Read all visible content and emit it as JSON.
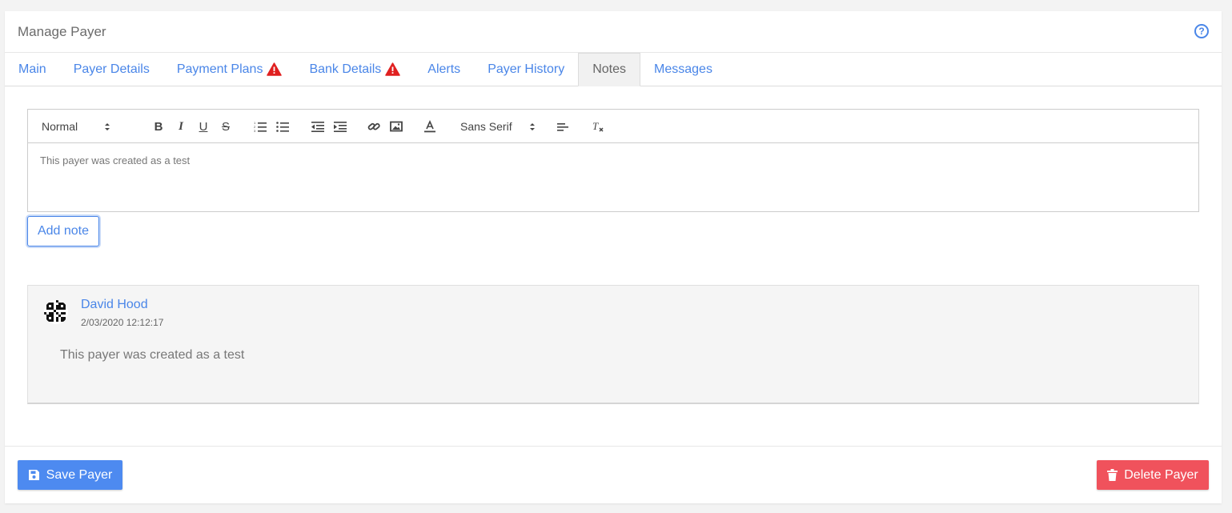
{
  "header": {
    "title": "Manage Payer",
    "help_icon": "question-circle-icon"
  },
  "tabs": [
    {
      "label": "Main",
      "warning": false
    },
    {
      "label": "Payer Details",
      "warning": false
    },
    {
      "label": "Payment Plans",
      "warning": true
    },
    {
      "label": "Bank Details",
      "warning": true
    },
    {
      "label": "Alerts",
      "warning": false
    },
    {
      "label": "Payer History",
      "warning": false
    },
    {
      "label": "Notes",
      "warning": false,
      "active": true
    },
    {
      "label": "Messages",
      "warning": false
    }
  ],
  "editor": {
    "heading_select": "Normal",
    "font_select": "Sans Serif",
    "content": "This payer was created as a test"
  },
  "add_note_label": "Add note",
  "notes": [
    {
      "author": "David Hood",
      "date": "2/03/2020 12:12:17",
      "text": "This payer was created as a test"
    }
  ],
  "footer": {
    "save_label": "Save Payer",
    "delete_label": "Delete Payer"
  },
  "colors": {
    "accent": "#4a86e8",
    "primary_button": "#4d8af0",
    "danger_button": "#f0525c",
    "warning": "#e02020"
  }
}
